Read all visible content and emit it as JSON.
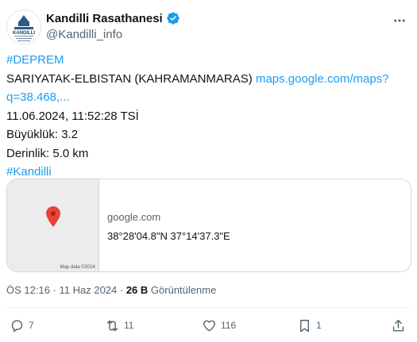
{
  "author": {
    "display_name": "Kandilli Rasathanesi",
    "handle": "@Kandilli_info",
    "avatar_text": "KANDILLI",
    "verified_icon": "verified-badge-icon",
    "verified_color": "#1d9bf0"
  },
  "tweet": {
    "hashtag_deprem": "#DEPREM",
    "location": "SARIYATAK-ELBISTAN (KAHRAMANMARAS)",
    "map_link_part1": "maps.google.com/maps?",
    "map_link_part2": "q=38.468,...",
    "datetime_line": "11.06.2024, 11:52:28 TSİ",
    "magnitude_line": "Büyüklük: 3.2",
    "depth_line": "Derinlik: 5.0 km",
    "hashtag_kandilli": "#Kandilli"
  },
  "card": {
    "map_credit": "Map data ©2024",
    "domain": "google.com",
    "coordinates": "38°28'04.8\"N 37°14'37.3\"E",
    "pin_color": "#ea4335"
  },
  "meta": {
    "time": "ÖS 12:16",
    "separator": " · ",
    "date": "11 Haz 2024",
    "views_count": "26 B",
    "views_label": "Görüntülenme"
  },
  "actions": {
    "replies": "7",
    "reposts": "11",
    "likes": "116",
    "bookmarks": "1"
  },
  "colors": {
    "link": "#1d9bf0",
    "text": "#0f1419",
    "muted": "#536471",
    "border": "#cfd9de"
  }
}
